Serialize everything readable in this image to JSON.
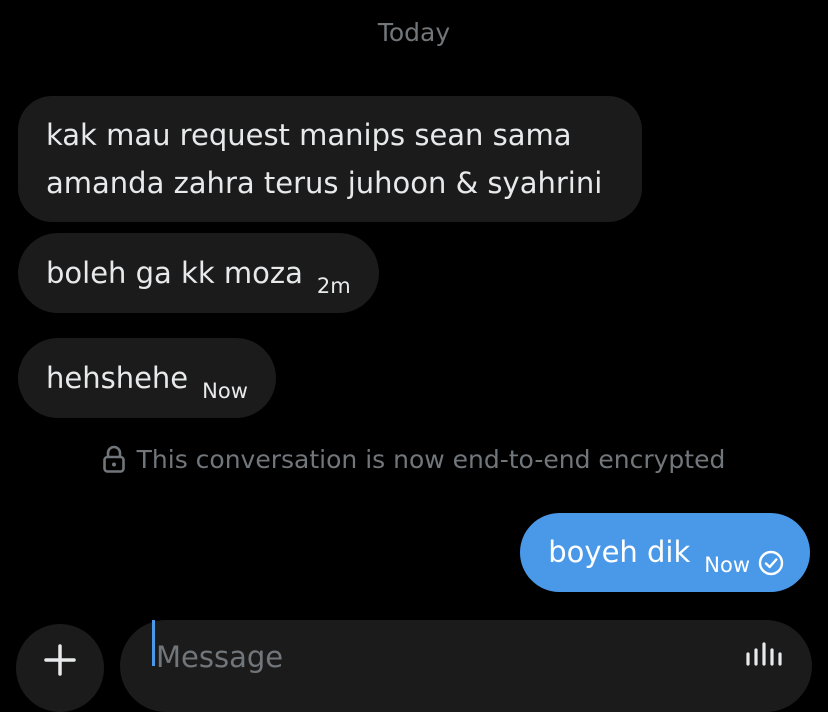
{
  "date_separator": "Today",
  "messages": [
    {
      "text_line1": "kak mau request manips sean sama",
      "text_line2": "amanda zahra terus juhoon & syahrini",
      "time": ""
    },
    {
      "text": "boleh ga kk moza",
      "time": "2m"
    },
    {
      "text": "hehshehe",
      "time": "Now"
    }
  ],
  "encryption_notice": "This conversation is now end-to-end encrypted",
  "outgoing": {
    "text": "boyeh dik",
    "time": "Now"
  },
  "composer": {
    "placeholder": "Message"
  },
  "icons": {
    "lock": "lock-icon",
    "read_check": "check-circle-icon",
    "plus": "plus-icon",
    "voice": "voice-wave-icon"
  },
  "colors": {
    "background": "#000000",
    "incoming_bubble": "#1b1b1c",
    "outgoing_bubble": "#4a99e9",
    "muted_text": "#71767b"
  }
}
